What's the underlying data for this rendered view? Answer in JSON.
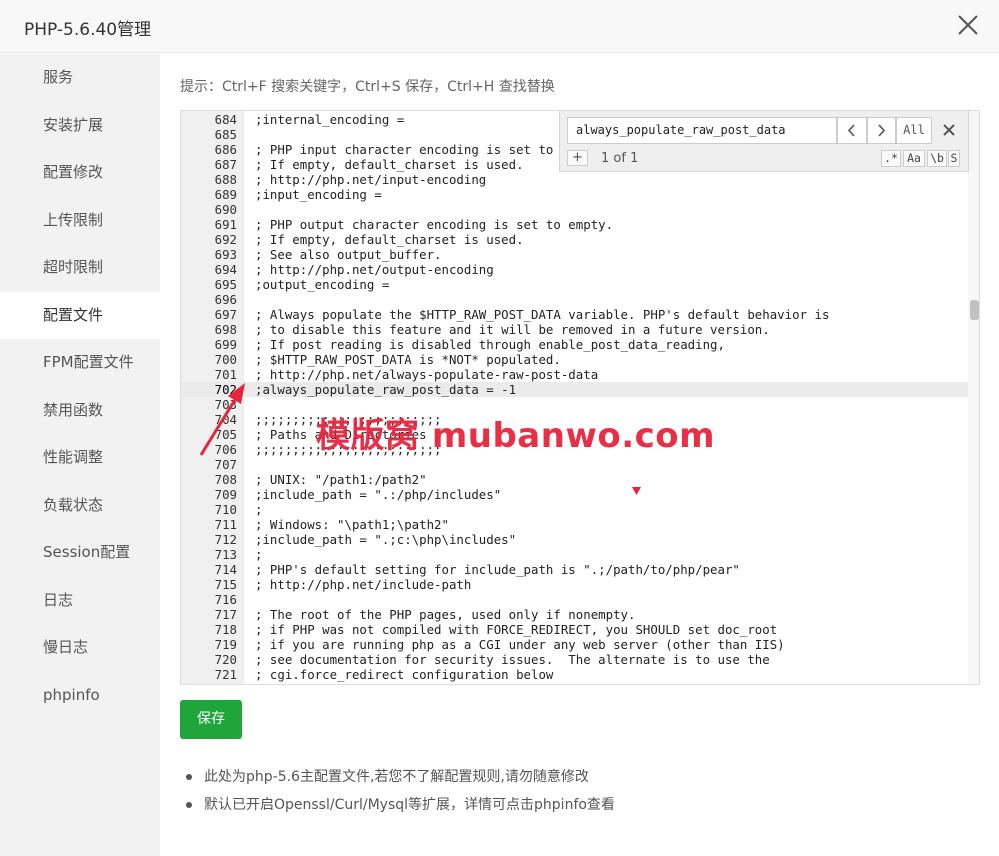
{
  "dialog": {
    "title": "PHP-5.6.40管理",
    "close_icon": "close-icon"
  },
  "sidebar": {
    "items": [
      {
        "label": "服务",
        "active": false
      },
      {
        "label": "安装扩展",
        "active": false
      },
      {
        "label": "配置修改",
        "active": false
      },
      {
        "label": "上传限制",
        "active": false
      },
      {
        "label": "超时限制",
        "active": false
      },
      {
        "label": "配置文件",
        "active": true
      },
      {
        "label": "FPM配置文件",
        "active": false
      },
      {
        "label": "禁用函数",
        "active": false
      },
      {
        "label": "性能调整",
        "active": false
      },
      {
        "label": "负载状态",
        "active": false
      },
      {
        "label": "Session配置",
        "active": false
      },
      {
        "label": "日志",
        "active": false
      },
      {
        "label": "慢日志",
        "active": false
      },
      {
        "label": "phpinfo",
        "active": false
      }
    ]
  },
  "hint": "提示：Ctrl+F 搜索关键字，Ctrl+S 保存，Ctrl+H 查找替换",
  "editor": {
    "highlighted_line": "702",
    "lines": [
      {
        "num": "684",
        "code": ";internal_encoding ="
      },
      {
        "num": "685",
        "code": ""
      },
      {
        "num": "686",
        "code": "; PHP input character encoding is set to e"
      },
      {
        "num": "687",
        "code": "; If empty, default_charset is used."
      },
      {
        "num": "688",
        "code": "; http://php.net/input-encoding"
      },
      {
        "num": "689",
        "code": ";input_encoding ="
      },
      {
        "num": "690",
        "code": ""
      },
      {
        "num": "691",
        "code": "; PHP output character encoding is set to empty."
      },
      {
        "num": "692",
        "code": "; If empty, default_charset is used."
      },
      {
        "num": "693",
        "code": "; See also output_buffer."
      },
      {
        "num": "694",
        "code": "; http://php.net/output-encoding"
      },
      {
        "num": "695",
        "code": ";output_encoding ="
      },
      {
        "num": "696",
        "code": ""
      },
      {
        "num": "697",
        "code": "; Always populate the $HTTP_RAW_POST_DATA variable. PHP's default behavior is"
      },
      {
        "num": "698",
        "code": "; to disable this feature and it will be removed in a future version."
      },
      {
        "num": "699",
        "code": "; If post reading is disabled through enable_post_data_reading,"
      },
      {
        "num": "700",
        "code": "; $HTTP_RAW_POST_DATA is *NOT* populated."
      },
      {
        "num": "701",
        "code": "; http://php.net/always-populate-raw-post-data"
      },
      {
        "num": "702",
        "code": ";always_populate_raw_post_data = -1"
      },
      {
        "num": "703",
        "code": ""
      },
      {
        "num": "704",
        "code": ";;;;;;;;;;;;;;;;;;;;;;;;;"
      },
      {
        "num": "705",
        "code": "; Paths and Directories ;"
      },
      {
        "num": "706",
        "code": ";;;;;;;;;;;;;;;;;;;;;;;;;"
      },
      {
        "num": "707",
        "code": ""
      },
      {
        "num": "708",
        "code": "; UNIX: \"/path1:/path2\""
      },
      {
        "num": "709",
        "code": ";include_path = \".:/php/includes\""
      },
      {
        "num": "710",
        "code": ";"
      },
      {
        "num": "711",
        "code": "; Windows: \"\\path1;\\path2\""
      },
      {
        "num": "712",
        "code": ";include_path = \".;c:\\php\\includes\""
      },
      {
        "num": "713",
        "code": ";"
      },
      {
        "num": "714",
        "code": "; PHP's default setting for include_path is \".;/path/to/php/pear\""
      },
      {
        "num": "715",
        "code": "; http://php.net/include-path"
      },
      {
        "num": "716",
        "code": ""
      },
      {
        "num": "717",
        "code": "; The root of the PHP pages, used only if nonempty."
      },
      {
        "num": "718",
        "code": "; if PHP was not compiled with FORCE_REDIRECT, you SHOULD set doc_root"
      },
      {
        "num": "719",
        "code": "; if you are running php as a CGI under any web server (other than IIS)"
      },
      {
        "num": "720",
        "code": "; see documentation for security issues.  The alternate is to use the"
      },
      {
        "num": "721",
        "code": "; cgi.force_redirect configuration below"
      }
    ]
  },
  "search": {
    "value": "always_populate_raw_post_data",
    "prev_label": "‹",
    "next_label": "›",
    "all_label": "All",
    "plus_label": "+",
    "count": "1 of 1",
    "options": [
      ".*",
      "Aa",
      "\\b",
      "S"
    ]
  },
  "save_label": "保存",
  "notes": [
    "此处为php-5.6主配置文件,若您不了解配置规则,请勿随意修改",
    "默认已开启Openssl/Curl/Mysql等扩展，详情可点击phpinfo查看"
  ],
  "watermark": "模版窝 mubanwo.com",
  "colors": {
    "accent_green": "#20a53a",
    "annotation_red": "#e8243d"
  }
}
